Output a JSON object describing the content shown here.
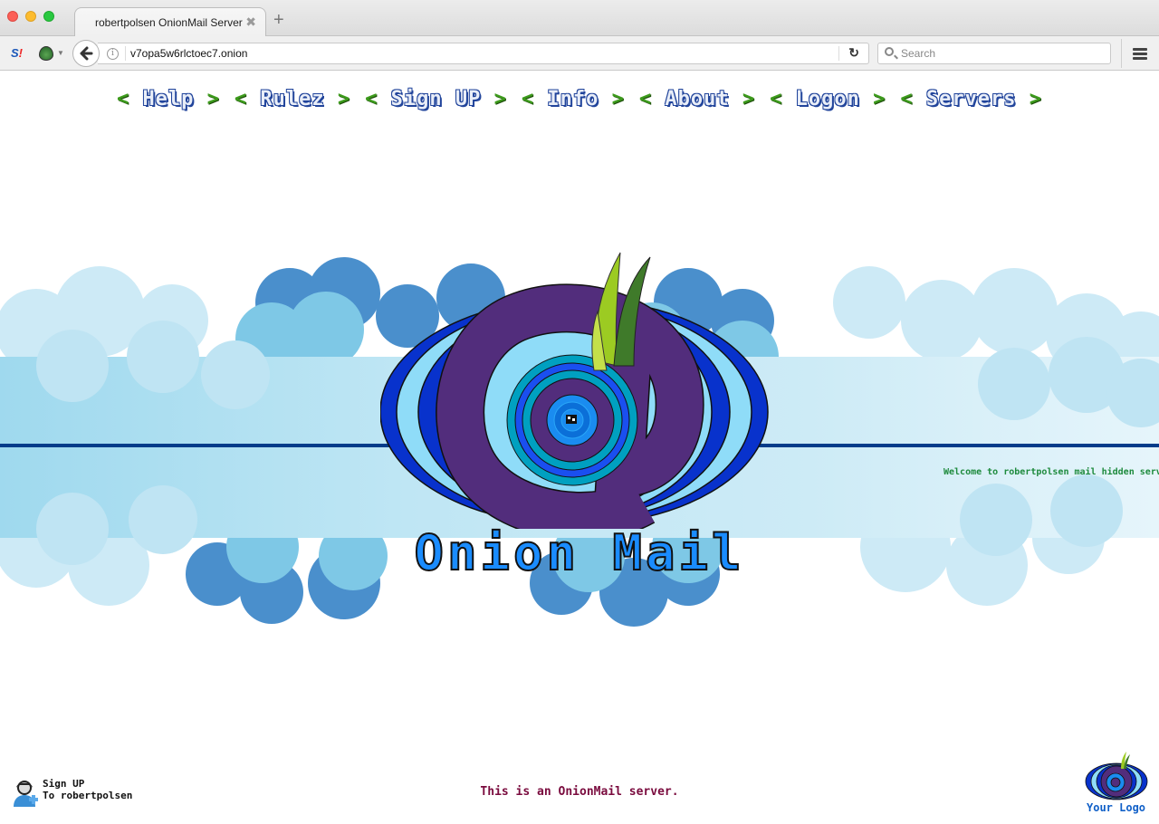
{
  "browser": {
    "tab": {
      "title": "robertpolsen OnionMail Server",
      "close_glyph": "✖"
    },
    "new_tab_glyph": "+",
    "address": {
      "url": "v7opa5w6rlctoec7.onion"
    },
    "search": {
      "placeholder": "Search"
    },
    "back_glyph": "🡐",
    "reload_glyph": "↻",
    "extensions": {
      "sp_label": "S",
      "sp_exclaim": "!"
    }
  },
  "page": {
    "nav": [
      {
        "label": "Help"
      },
      {
        "label": "Rulez"
      },
      {
        "label": "Sign UP"
      },
      {
        "label": "Info"
      },
      {
        "label": "About"
      },
      {
        "label": "Logon"
      },
      {
        "label": "Servers"
      }
    ],
    "nav_bracket_left": "<",
    "nav_bracket_right": ">",
    "brand_title": "Onion Mail",
    "welcome_marquee": "Welcome to robertpolsen mail hidden server",
    "signup_widget": {
      "line1": "Sign UP",
      "line2": "To robertpolsen"
    },
    "footer_text": "This is an OnionMail server.",
    "your_logo": "Your Logo"
  },
  "colors": {
    "nav_bracket": "#3d9b1c",
    "nav_label_outline": "#21449b",
    "brand_fill": "#1a8cff",
    "welcome": "#1d8a3c",
    "footer_text": "#7a0b3e",
    "divider": "#033c8a"
  }
}
